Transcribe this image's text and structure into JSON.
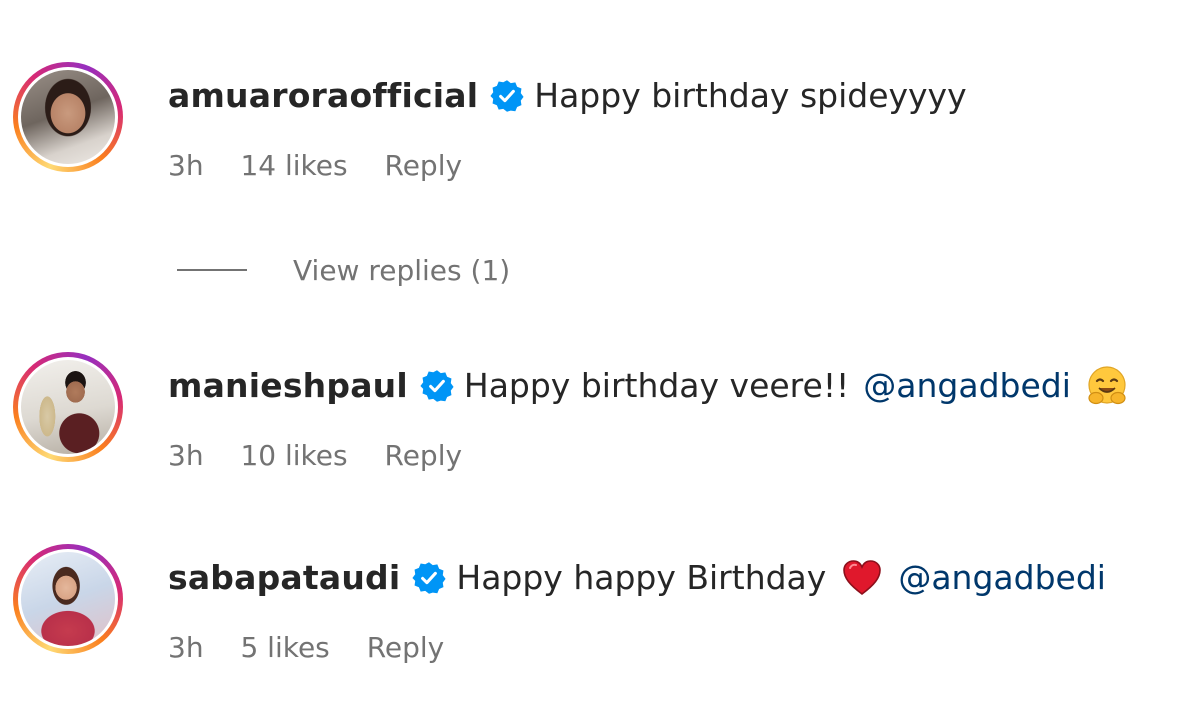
{
  "comments": [
    {
      "username": "amuaroraofficial",
      "text": "Happy birthday spideyyyy",
      "mention": "",
      "emoji": "",
      "time": "3h",
      "likes": "14 likes",
      "reply": "Reply"
    },
    {
      "username": "manieshpaul",
      "text": "Happy birthday veere!!",
      "mention": "@angadbedi",
      "emoji": "hugging-face-emoji",
      "time": "3h",
      "likes": "10 likes",
      "reply": "Reply"
    },
    {
      "username": "sabapataudi",
      "text": "Happy happy Birthday",
      "mention": "@angadbedi",
      "emoji": "red-heart-emoji",
      "time": "3h",
      "likes": "5 likes",
      "reply": "Reply"
    }
  ],
  "view_replies": "View replies (1)",
  "colors": {
    "verified_badge": "#0095f6",
    "mention": "#00376b",
    "meta_text": "#737373",
    "primary_text": "#262626"
  }
}
